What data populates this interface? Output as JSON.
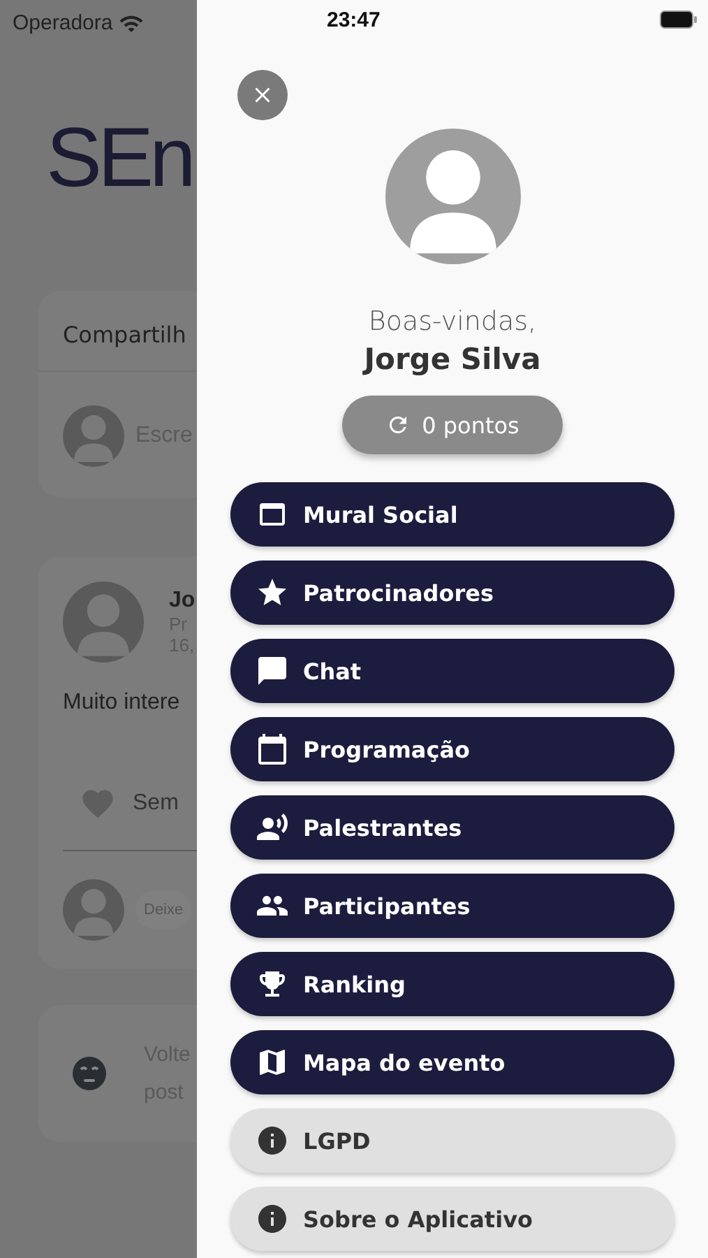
{
  "status_bar": {
    "carrier": "Operadora",
    "time": "23:47"
  },
  "background": {
    "logo": "SEn",
    "share_card": {
      "title": "Compartilh",
      "placeholder": "Escre"
    },
    "post": {
      "author": "Jo",
      "subtitle": "Pr",
      "date": "16,",
      "text": "Muito intere",
      "likes": "Sem",
      "comment_placeholder": "Deixe"
    },
    "notice": {
      "lines": [
        "Volte",
        "post"
      ]
    }
  },
  "drawer": {
    "greeting": "Boas-vindas,",
    "name": "Jorge Silva",
    "points": "0 pontos",
    "menu": [
      {
        "label": "Mural Social",
        "kind": "primary"
      },
      {
        "label": "Patrocinadores",
        "kind": "primary"
      },
      {
        "label": "Chat",
        "kind": "primary"
      },
      {
        "label": "Programação",
        "kind": "primary"
      },
      {
        "label": "Palestrantes",
        "kind": "primary"
      },
      {
        "label": "Participantes",
        "kind": "primary"
      },
      {
        "label": "Ranking",
        "kind": "primary"
      },
      {
        "label": "Mapa do evento",
        "kind": "primary"
      },
      {
        "label": "LGPD",
        "kind": "secondary"
      },
      {
        "label": "Sobre o Aplicativo",
        "kind": "secondary"
      }
    ]
  }
}
